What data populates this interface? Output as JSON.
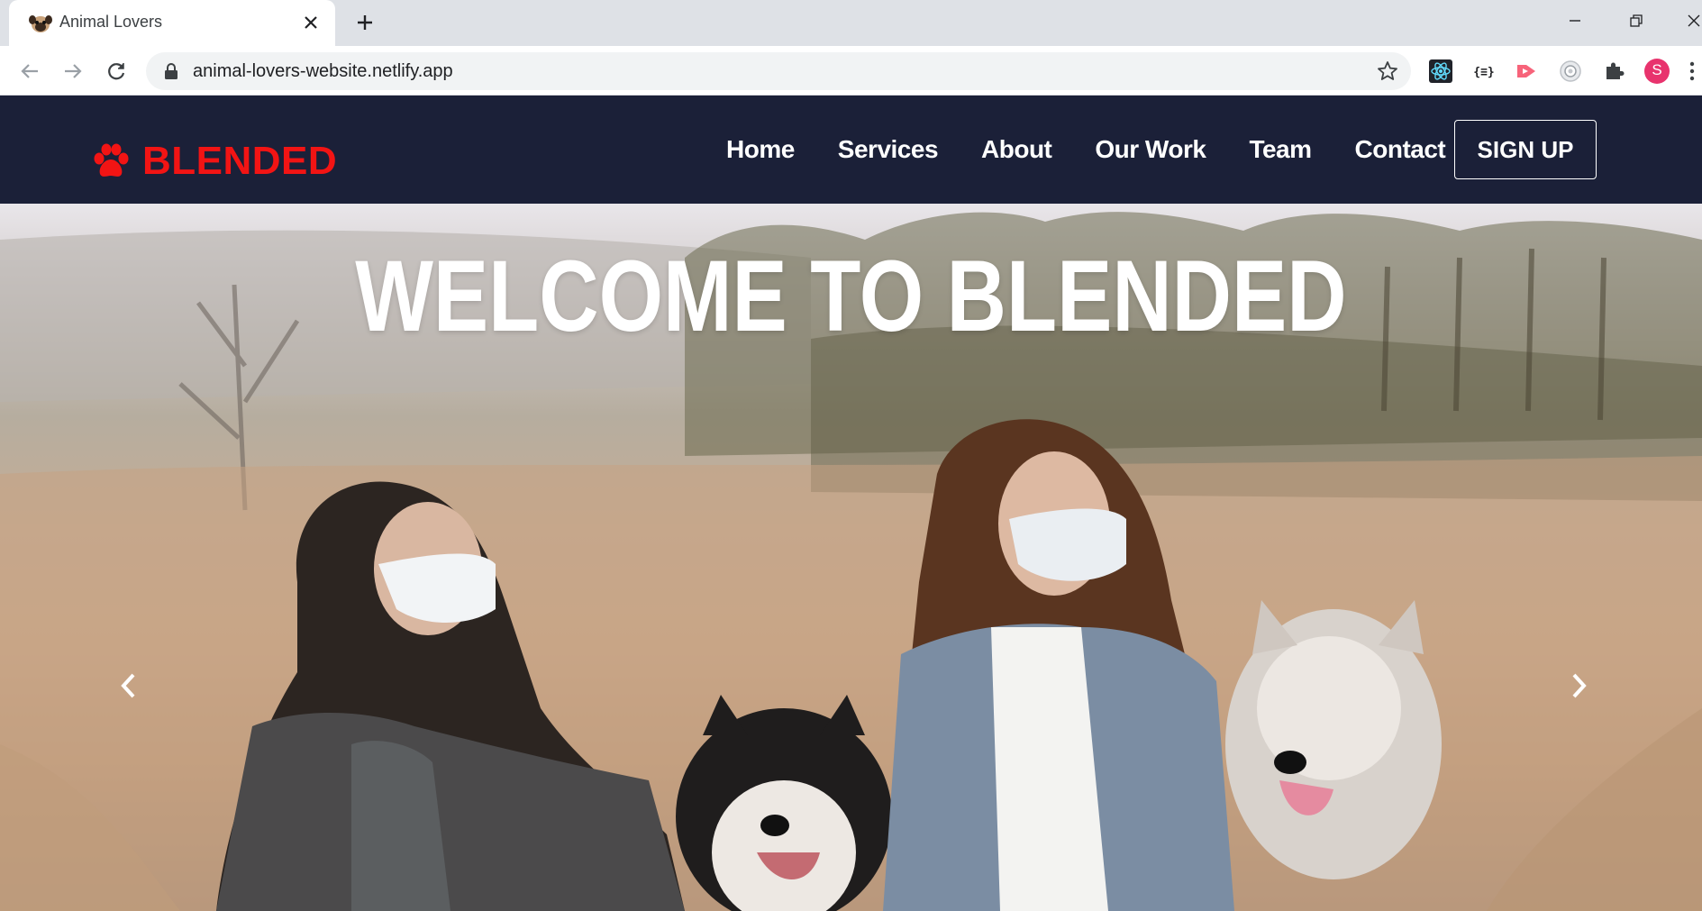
{
  "browser": {
    "tab_title": "Animal Lovers",
    "url": "animal-lovers-website.netlify.app",
    "profile_initial": "S"
  },
  "site": {
    "brand": "BLENDED",
    "brand_color": "#f21414",
    "nav_bg": "#1b2038",
    "nav": [
      {
        "label": "Home"
      },
      {
        "label": "Services"
      },
      {
        "label": "About"
      },
      {
        "label": "Our Work"
      },
      {
        "label": "Team"
      },
      {
        "label": "Contact"
      }
    ],
    "signup_label": "SIGN UP",
    "hero_title": "WELCOME TO BLENDED"
  },
  "icons": {
    "tab_favicon": "pug-icon",
    "brand": "paw-icon",
    "extensions": [
      "react-devtools-icon",
      "json-viewer-icon",
      "arrow-extension-icon",
      "camera-extension-icon",
      "puzzle-icon"
    ]
  }
}
